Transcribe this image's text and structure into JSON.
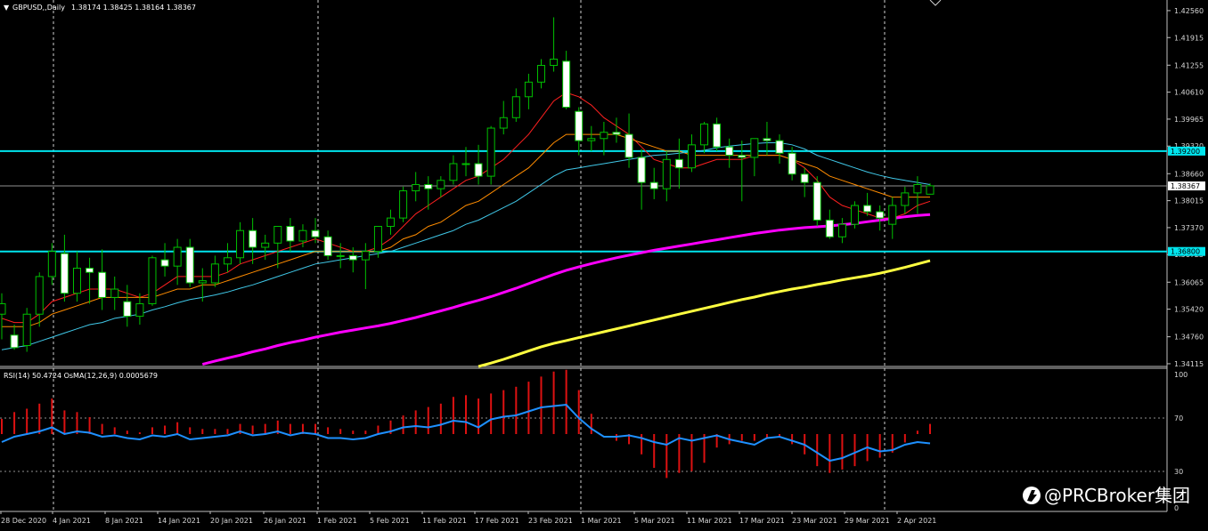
{
  "header": {
    "symbol": "GBPUSD,,Daily",
    "ohlc": "1.38174 1.38425 1.38164 1.38367"
  },
  "subwindow": {
    "label": "RSI(14) 50.4724 OsMA(12,26,9) 0.0005679",
    "levels": [
      100,
      70,
      30,
      0
    ],
    "rsi_color": "#1e90ff",
    "osma_color": "#dd1111"
  },
  "price_axis": {
    "min": 1.3405,
    "max": 1.4275,
    "ticks": [
      "1.42560",
      "1.41915",
      "1.41255",
      "1.40610",
      "1.39965",
      "1.39320",
      "1.38660",
      "1.38015",
      "1.37370",
      "1.36725",
      "1.36065",
      "1.35420",
      "1.34760",
      "1.34115"
    ]
  },
  "time_axis": {
    "labels": [
      "28 Dec 2020",
      "4 Jan 2021",
      "8 Jan 2021",
      "14 Jan 2021",
      "20 Jan 2021",
      "26 Jan 2021",
      "1 Feb 2021",
      "5 Feb 2021",
      "11 Feb 2021",
      "17 Feb 2021",
      "23 Feb 2021",
      "1 Mar 2021",
      "5 Mar 2021",
      "11 Mar 2021",
      "17 Mar 2021",
      "23 Mar 2021",
      "29 Mar 2021",
      "2 Apr 2021"
    ]
  },
  "levels": {
    "resistance": "1.39200",
    "current": "1.38367",
    "support": "1.36800",
    "line_color": "#00e5ee"
  },
  "colors": {
    "bull_candle": "#000000",
    "bear_candle": "#ffffff",
    "wick": "#00c000",
    "ma_fast": "#ff2020",
    "ma_mid": "#ff8c00",
    "ma_slow": "#40c8e8",
    "ma_100": "#ff00ff",
    "ma_200": "#ffff40"
  },
  "watermark": "@PRCBroker集团",
  "chart_data": {
    "type": "candlestick",
    "timeframe": "Daily",
    "candles": [
      {
        "o": 1.353,
        "h": 1.358,
        "l": 1.347,
        "c": 1.3555
      },
      {
        "o": 1.348,
        "h": 1.3505,
        "l": 1.3445,
        "c": 1.345
      },
      {
        "o": 1.3455,
        "h": 1.3545,
        "l": 1.344,
        "c": 1.353
      },
      {
        "o": 1.353,
        "h": 1.363,
        "l": 1.35,
        "c": 1.362
      },
      {
        "o": 1.362,
        "h": 1.37,
        "l": 1.36,
        "c": 1.368
      },
      {
        "o": 1.3675,
        "h": 1.372,
        "l": 1.356,
        "c": 1.358
      },
      {
        "o": 1.358,
        "h": 1.368,
        "l": 1.356,
        "c": 1.364
      },
      {
        "o": 1.364,
        "h": 1.3665,
        "l": 1.3555,
        "c": 1.363
      },
      {
        "o": 1.363,
        "h": 1.3685,
        "l": 1.354,
        "c": 1.357
      },
      {
        "o": 1.357,
        "h": 1.362,
        "l": 1.354,
        "c": 1.359
      },
      {
        "o": 1.356,
        "h": 1.36,
        "l": 1.35,
        "c": 1.3525
      },
      {
        "o": 1.3525,
        "h": 1.358,
        "l": 1.3505,
        "c": 1.3555
      },
      {
        "o": 1.3555,
        "h": 1.367,
        "l": 1.355,
        "c": 1.3665
      },
      {
        "o": 1.366,
        "h": 1.37,
        "l": 1.362,
        "c": 1.3645
      },
      {
        "o": 1.3645,
        "h": 1.371,
        "l": 1.36,
        "c": 1.369
      },
      {
        "o": 1.369,
        "h": 1.371,
        "l": 1.3595,
        "c": 1.3605
      },
      {
        "o": 1.3605,
        "h": 1.364,
        "l": 1.356,
        "c": 1.361
      },
      {
        "o": 1.3605,
        "h": 1.367,
        "l": 1.3595,
        "c": 1.365
      },
      {
        "o": 1.365,
        "h": 1.37,
        "l": 1.363,
        "c": 1.3665
      },
      {
        "o": 1.3665,
        "h": 1.375,
        "l": 1.365,
        "c": 1.373
      },
      {
        "o": 1.373,
        "h": 1.376,
        "l": 1.365,
        "c": 1.369
      },
      {
        "o": 1.369,
        "h": 1.372,
        "l": 1.366,
        "c": 1.37
      },
      {
        "o": 1.37,
        "h": 1.374,
        "l": 1.364,
        "c": 1.374
      },
      {
        "o": 1.374,
        "h": 1.376,
        "l": 1.368,
        "c": 1.3705
      },
      {
        "o": 1.3705,
        "h": 1.3745,
        "l": 1.369,
        "c": 1.373
      },
      {
        "o": 1.373,
        "h": 1.376,
        "l": 1.37,
        "c": 1.3715
      },
      {
        "o": 1.3715,
        "h": 1.373,
        "l": 1.366,
        "c": 1.367
      },
      {
        "o": 1.367,
        "h": 1.37,
        "l": 1.364,
        "c": 1.367
      },
      {
        "o": 1.367,
        "h": 1.369,
        "l": 1.363,
        "c": 1.366
      },
      {
        "o": 1.366,
        "h": 1.37,
        "l": 1.359,
        "c": 1.368
      },
      {
        "o": 1.368,
        "h": 1.374,
        "l": 1.3665,
        "c": 1.374
      },
      {
        "o": 1.374,
        "h": 1.378,
        "l": 1.372,
        "c": 1.376
      },
      {
        "o": 1.376,
        "h": 1.3835,
        "l": 1.375,
        "c": 1.3825
      },
      {
        "o": 1.3825,
        "h": 1.387,
        "l": 1.38,
        "c": 1.384
      },
      {
        "o": 1.384,
        "h": 1.386,
        "l": 1.378,
        "c": 1.383
      },
      {
        "o": 1.383,
        "h": 1.386,
        "l": 1.381,
        "c": 1.385
      },
      {
        "o": 1.385,
        "h": 1.391,
        "l": 1.384,
        "c": 1.389
      },
      {
        "o": 1.389,
        "h": 1.393,
        "l": 1.386,
        "c": 1.389
      },
      {
        "o": 1.389,
        "h": 1.3935,
        "l": 1.384,
        "c": 1.386
      },
      {
        "o": 1.386,
        "h": 1.398,
        "l": 1.384,
        "c": 1.3975
      },
      {
        "o": 1.3975,
        "h": 1.404,
        "l": 1.396,
        "c": 1.4
      },
      {
        "o": 1.4,
        "h": 1.407,
        "l": 1.399,
        "c": 1.405
      },
      {
        "o": 1.405,
        "h": 1.4105,
        "l": 1.402,
        "c": 1.4085
      },
      {
        "o": 1.4085,
        "h": 1.414,
        "l": 1.407,
        "c": 1.4125
      },
      {
        "o": 1.4125,
        "h": 1.424,
        "l": 1.411,
        "c": 1.414
      },
      {
        "o": 1.4135,
        "h": 1.416,
        "l": 1.402,
        "c": 1.4025
      },
      {
        "o": 1.4015,
        "h": 1.4025,
        "l": 1.391,
        "c": 1.3945
      },
      {
        "o": 1.3945,
        "h": 1.398,
        "l": 1.392,
        "c": 1.395
      },
      {
        "o": 1.395,
        "h": 1.399,
        "l": 1.391,
        "c": 1.3965
      },
      {
        "o": 1.3965,
        "h": 1.4,
        "l": 1.394,
        "c": 1.396
      },
      {
        "o": 1.396,
        "h": 1.401,
        "l": 1.388,
        "c": 1.3905
      },
      {
        "o": 1.3905,
        "h": 1.3925,
        "l": 1.378,
        "c": 1.3845
      },
      {
        "o": 1.3845,
        "h": 1.388,
        "l": 1.3805,
        "c": 1.383
      },
      {
        "o": 1.383,
        "h": 1.392,
        "l": 1.38,
        "c": 1.39
      },
      {
        "o": 1.39,
        "h": 1.395,
        "l": 1.383,
        "c": 1.388
      },
      {
        "o": 1.388,
        "h": 1.396,
        "l": 1.387,
        "c": 1.3935
      },
      {
        "o": 1.3935,
        "h": 1.399,
        "l": 1.3915,
        "c": 1.3985
      },
      {
        "o": 1.3985,
        "h": 1.4,
        "l": 1.392,
        "c": 1.393
      },
      {
        "o": 1.393,
        "h": 1.395,
        "l": 1.388,
        "c": 1.391
      },
      {
        "o": 1.391,
        "h": 1.3945,
        "l": 1.38,
        "c": 1.3905
      },
      {
        "o": 1.3905,
        "h": 1.395,
        "l": 1.386,
        "c": 1.395
      },
      {
        "o": 1.395,
        "h": 1.399,
        "l": 1.391,
        "c": 1.3945
      },
      {
        "o": 1.3945,
        "h": 1.396,
        "l": 1.389,
        "c": 1.3915
      },
      {
        "o": 1.3915,
        "h": 1.393,
        "l": 1.385,
        "c": 1.3865
      },
      {
        "o": 1.3865,
        "h": 1.388,
        "l": 1.381,
        "c": 1.3845
      },
      {
        "o": 1.3845,
        "h": 1.386,
        "l": 1.374,
        "c": 1.3755
      },
      {
        "o": 1.3755,
        "h": 1.378,
        "l": 1.371,
        "c": 1.3715
      },
      {
        "o": 1.3715,
        "h": 1.376,
        "l": 1.37,
        "c": 1.3745
      },
      {
        "o": 1.3745,
        "h": 1.38,
        "l": 1.3735,
        "c": 1.379
      },
      {
        "o": 1.379,
        "h": 1.382,
        "l": 1.3765,
        "c": 1.3775
      },
      {
        "o": 1.3775,
        "h": 1.379,
        "l": 1.373,
        "c": 1.376
      },
      {
        "o": 1.3745,
        "h": 1.381,
        "l": 1.371,
        "c": 1.379
      },
      {
        "o": 1.379,
        "h": 1.3835,
        "l": 1.377,
        "c": 1.382
      },
      {
        "o": 1.382,
        "h": 1.386,
        "l": 1.377,
        "c": 1.384
      },
      {
        "o": 1.3817,
        "h": 1.3843,
        "l": 1.3816,
        "c": 1.3837
      }
    ],
    "indicators": [
      {
        "kind": "ma_fast",
        "values": [
          1.352,
          1.351,
          1.351,
          1.353,
          1.356,
          1.357,
          1.358,
          1.359,
          1.359,
          1.359,
          1.358,
          1.357,
          1.358,
          1.36,
          1.362,
          1.362,
          1.362,
          1.362,
          1.363,
          1.365,
          1.366,
          1.367,
          1.368,
          1.369,
          1.37,
          1.371,
          1.37,
          1.369,
          1.368,
          1.368,
          1.369,
          1.371,
          1.374,
          1.377,
          1.379,
          1.381,
          1.383,
          1.385,
          1.386,
          1.388,
          1.39,
          1.393,
          1.396,
          1.4,
          1.404,
          1.406,
          1.405,
          1.403,
          1.4,
          1.398,
          1.396,
          1.393,
          1.39,
          1.389,
          1.388,
          1.388,
          1.389,
          1.39,
          1.39,
          1.39,
          1.391,
          1.391,
          1.391,
          1.39,
          1.388,
          1.385,
          1.381,
          1.379,
          1.378,
          1.377,
          1.376,
          1.376,
          1.377,
          1.379,
          1.38
        ]
      },
      {
        "kind": "ma_mid",
        "values": [
          1.35,
          1.35,
          1.35,
          1.351,
          1.353,
          1.354,
          1.355,
          1.356,
          1.357,
          1.357,
          1.357,
          1.357,
          1.357,
          1.358,
          1.359,
          1.359,
          1.36,
          1.36,
          1.361,
          1.362,
          1.363,
          1.364,
          1.365,
          1.366,
          1.367,
          1.368,
          1.368,
          1.368,
          1.368,
          1.368,
          1.368,
          1.369,
          1.371,
          1.372,
          1.374,
          1.375,
          1.377,
          1.379,
          1.38,
          1.382,
          1.384,
          1.386,
          1.388,
          1.391,
          1.394,
          1.396,
          1.396,
          1.396,
          1.396,
          1.396,
          1.395,
          1.394,
          1.393,
          1.392,
          1.392,
          1.391,
          1.391,
          1.391,
          1.391,
          1.391,
          1.391,
          1.391,
          1.391,
          1.39,
          1.389,
          1.388,
          1.386,
          1.385,
          1.384,
          1.383,
          1.382,
          1.381,
          1.381,
          1.381,
          1.381
        ]
      },
      {
        "kind": "ma_slow",
        "values": [
          1.3445,
          1.345,
          1.3455,
          1.3465,
          1.3475,
          1.3485,
          1.3495,
          1.3505,
          1.351,
          1.352,
          1.3525,
          1.353,
          1.354,
          1.3548,
          1.3557,
          1.3565,
          1.357,
          1.3576,
          1.3583,
          1.3592,
          1.36,
          1.361,
          1.362,
          1.363,
          1.364,
          1.365,
          1.3655,
          1.366,
          1.3665,
          1.367,
          1.3675,
          1.368,
          1.369,
          1.37,
          1.371,
          1.372,
          1.373,
          1.3745,
          1.3755,
          1.377,
          1.3785,
          1.38,
          1.382,
          1.384,
          1.386,
          1.3875,
          1.388,
          1.3885,
          1.389,
          1.3895,
          1.39,
          1.3905,
          1.391,
          1.3912,
          1.3915,
          1.3918,
          1.3922,
          1.3928,
          1.3932,
          1.3935,
          1.3938,
          1.394,
          1.394,
          1.3935,
          1.3925,
          1.391,
          1.39,
          1.389,
          1.388,
          1.387,
          1.3862,
          1.3855,
          1.385,
          1.3845,
          1.384
        ]
      },
      {
        "kind": "ma_100",
        "values": [
          null,
          null,
          null,
          null,
          null,
          null,
          null,
          null,
          null,
          null,
          null,
          null,
          null,
          null,
          null,
          null,
          1.341,
          1.3418,
          1.3425,
          1.3432,
          1.344,
          1.3447,
          1.3455,
          1.3462,
          1.3468,
          1.3475,
          1.3481,
          1.3487,
          1.3492,
          1.3497,
          1.3502,
          1.3508,
          1.3515,
          1.3522,
          1.353,
          1.3538,
          1.3546,
          1.3555,
          1.3563,
          1.3572,
          1.3582,
          1.3592,
          1.3603,
          1.3614,
          1.3625,
          1.3635,
          1.3643,
          1.3651,
          1.3658,
          1.3665,
          1.3671,
          1.3677,
          1.3683,
          1.3688,
          1.3693,
          1.3698,
          1.3703,
          1.3708,
          1.3713,
          1.3718,
          1.3723,
          1.3727,
          1.3731,
          1.3734,
          1.3737,
          1.3739,
          1.3741,
          1.3744,
          1.3747,
          1.3751,
          1.3755,
          1.3759,
          1.3763,
          1.3766,
          1.3768
        ]
      },
      {
        "kind": "ma_200",
        "values": [
          null,
          null,
          null,
          null,
          null,
          null,
          null,
          null,
          null,
          null,
          null,
          null,
          null,
          null,
          null,
          null,
          null,
          null,
          null,
          null,
          null,
          null,
          null,
          null,
          null,
          null,
          null,
          null,
          null,
          null,
          null,
          null,
          null,
          null,
          null,
          null,
          null,
          null,
          1.3405,
          1.3413,
          1.3422,
          1.3432,
          1.3442,
          1.3452,
          1.346,
          1.3467,
          1.3474,
          1.3481,
          1.3488,
          1.3495,
          1.3502,
          1.3509,
          1.3516,
          1.3523,
          1.353,
          1.3537,
          1.3544,
          1.3551,
          1.3558,
          1.3565,
          1.3571,
          1.3578,
          1.3584,
          1.359,
          1.3595,
          1.3601,
          1.3606,
          1.3612,
          1.3617,
          1.3622,
          1.3628,
          1.3635,
          1.3642,
          1.365,
          1.3658
        ]
      }
    ],
    "rsi": [
      52,
      56,
      58,
      60,
      63,
      58,
      60,
      59,
      56,
      57,
      55,
      54,
      57,
      56,
      58,
      54,
      55,
      56,
      57,
      60,
      57,
      58,
      60,
      57,
      59,
      58,
      55,
      55,
      54,
      55,
      58,
      60,
      63,
      64,
      63,
      65,
      68,
      67,
      63,
      69,
      71,
      72,
      75,
      78,
      79,
      80,
      70,
      62,
      56,
      56,
      57,
      55,
      52,
      50,
      55,
      53,
      55,
      57,
      54,
      52,
      50,
      55,
      56,
      53,
      50,
      44,
      38,
      40,
      44,
      48,
      45,
      46,
      50,
      52,
      51
    ],
    "osma": [
      0.0009,
      0.0013,
      0.0015,
      0.0018,
      0.0021,
      0.0014,
      0.0013,
      0.001,
      0.0006,
      0.0004,
      0.0002,
      0.0001,
      0.0004,
      0.0005,
      0.0007,
      0.0004,
      0.0003,
      0.0003,
      0.0003,
      0.0006,
      0.0005,
      0.0006,
      0.0008,
      0.0006,
      0.0006,
      0.0006,
      0.0004,
      0.0003,
      0.0002,
      0.0002,
      0.0005,
      0.0008,
      0.0011,
      0.0014,
      0.0016,
      0.0018,
      0.0022,
      0.0023,
      0.0021,
      0.0024,
      0.0026,
      0.0028,
      0.0031,
      0.0034,
      0.0037,
      0.0038,
      0.0026,
      0.0012,
      0.0,
      -0.0004,
      -0.0006,
      -0.0012,
      -0.002,
      -0.0026,
      -0.0023,
      -0.0022,
      -0.0017,
      -0.0008,
      -0.0006,
      -0.0004,
      -0.0004,
      -0.0002,
      -0.0002,
      -0.0006,
      -0.0012,
      -0.0019,
      -0.0023,
      -0.0021,
      -0.0019,
      -0.0016,
      -0.0014,
      -0.0011,
      -0.0005,
      0.0002,
      0.0006
    ],
    "xlim_bars": 75
  }
}
